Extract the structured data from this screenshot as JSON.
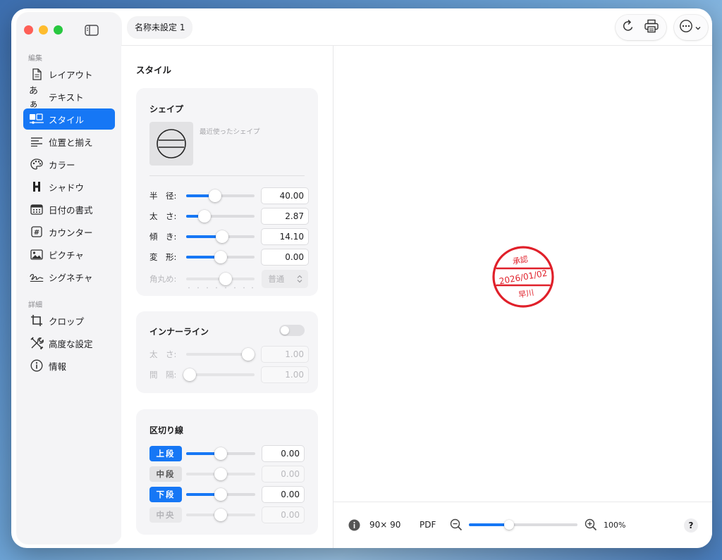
{
  "window": {
    "document_tab": "名称未設定 1"
  },
  "sidebar": {
    "section_edit": "編集",
    "section_detail": "詳細",
    "edit_items": [
      {
        "label": "レイアウト",
        "icon": "document-icon",
        "active": false
      },
      {
        "label": "テキスト",
        "icon": "text-aa-icon",
        "icon_text": "あぁ",
        "active": false
      },
      {
        "label": "スタイル",
        "icon": "style-icon",
        "active": true
      },
      {
        "label": "位置と揃え",
        "icon": "align-left-icon",
        "active": false
      },
      {
        "label": "カラー",
        "icon": "palette-icon",
        "active": false
      },
      {
        "label": "シャドウ",
        "icon": "shadow-icon",
        "active": false
      },
      {
        "label": "日付の書式",
        "icon": "calendar-icon",
        "active": false
      },
      {
        "label": "カウンター",
        "icon": "hash-icon",
        "active": false
      },
      {
        "label": "ピクチャ",
        "icon": "picture-icon",
        "active": false
      },
      {
        "label": "シグネチャ",
        "icon": "signature-icon",
        "active": false
      }
    ],
    "detail_items": [
      {
        "label": "クロップ",
        "icon": "crop-icon"
      },
      {
        "label": "高度な設定",
        "icon": "wrench-screwdriver-icon"
      },
      {
        "label": "情報",
        "icon": "info-icon"
      }
    ]
  },
  "panel": {
    "title": "スタイル",
    "shape": {
      "title": "シェイプ",
      "recent_label": "最近使ったシェイプ",
      "rows": [
        {
          "label": "半　径:",
          "value": "40.00",
          "fill": 0.42,
          "disabled": false
        },
        {
          "label": "太　さ:",
          "value": "2.87",
          "fill": 0.27,
          "disabled": false
        },
        {
          "label": "傾　き:",
          "value": "14.10",
          "fill": 0.53,
          "disabled": false
        },
        {
          "label": "変　形:",
          "value": "0.00",
          "fill": 0.5,
          "disabled": false
        }
      ],
      "corner": {
        "label": "角丸め:",
        "value": "普通",
        "fill": 0.58
      }
    },
    "innerline": {
      "title": "インナーライン",
      "enabled": false,
      "rows": [
        {
          "label": "太　さ:",
          "value": "1.00",
          "fill": 0.9
        },
        {
          "label": "間　隔:",
          "value": "1.00",
          "fill": 0.05
        }
      ]
    },
    "divider": {
      "title": "区切り線",
      "rows": [
        {
          "label": "上段",
          "value": "0.00",
          "state": "on",
          "fill": 0.5
        },
        {
          "label": "中段",
          "value": "0.00",
          "state": "off",
          "fill": 0.5
        },
        {
          "label": "下段",
          "value": "0.00",
          "state": "on",
          "fill": 0.5
        },
        {
          "label": "中央",
          "value": "0.00",
          "state": "dis",
          "fill": 0.5
        }
      ]
    }
  },
  "stamp": {
    "top": "承認",
    "middle": "2026/01/02",
    "bottom": "早川",
    "color": "#e0202a"
  },
  "footer": {
    "size": "90× 90",
    "format": "PDF",
    "zoom": "100%",
    "zoom_fill": 0.37,
    "help": "?"
  },
  "colors": {
    "accent": "#1677f5"
  }
}
